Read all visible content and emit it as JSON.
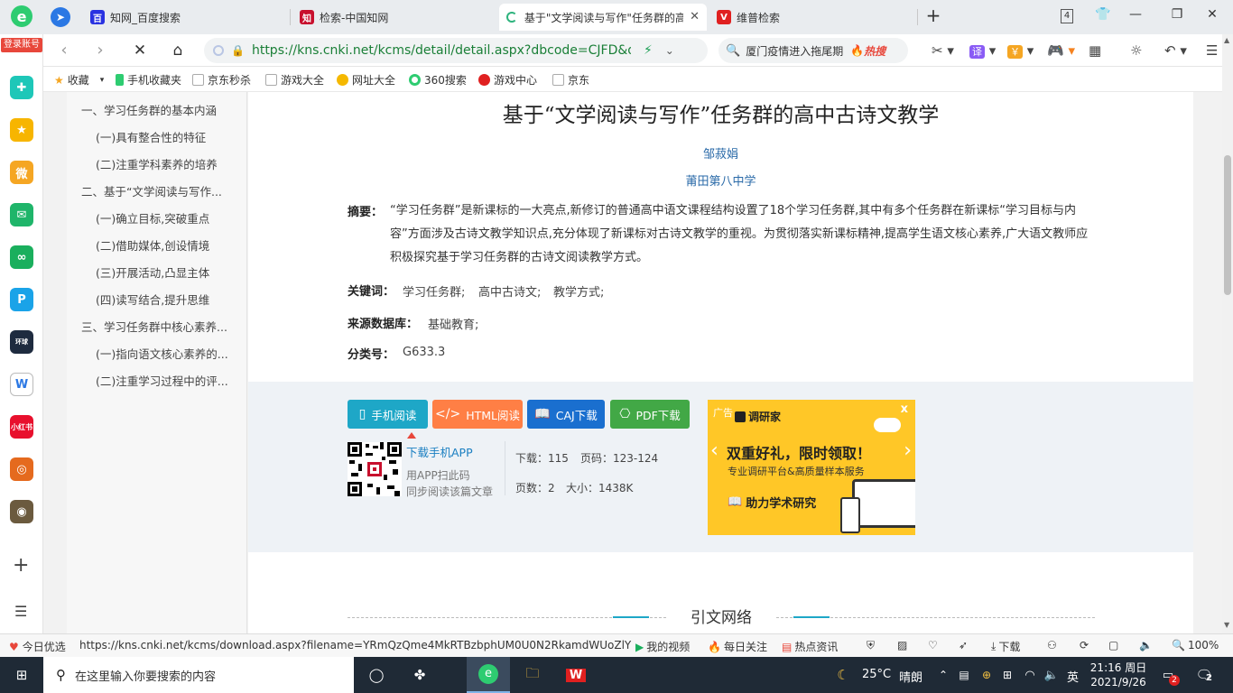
{
  "browser": {
    "tabs": [
      {
        "label": "知网_百度搜索",
        "icon": "baidu-icon",
        "color": "#2932e1",
        "active": false
      },
      {
        "label": "检索-中国知网",
        "icon": "cnki-icon",
        "color": "#c8102e",
        "active": false
      },
      {
        "label": "基于\"文学阅读与写作\"任务群的高中古诗文教学",
        "icon": "loading-icon",
        "color": "#2db37d",
        "active": true
      },
      {
        "label": "维普检索",
        "icon": "weipu-icon",
        "color": "#e02020",
        "active": false
      }
    ],
    "tab_count": "4",
    "address": "https://kns.cnki.net/kcms/detail/detail.aspx?dbcode=CJFD&d",
    "search_hint": "厦门疫情进入拖尾期",
    "search_hot": "热搜",
    "login_label": "登录账号"
  },
  "favorites": [
    "收藏",
    "手机收藏夹",
    "京东秒杀",
    "游戏大全",
    "网址大全",
    "360搜索",
    "游戏中心",
    "京东"
  ],
  "toc": [
    "一、学习任务群的基本内涵",
    "(一)具有整合性的特征",
    "(二)注重学科素养的培养",
    "二、基于“文学阅读与写作...",
    "(一)确立目标,突破重点",
    "(二)借助媒体,创设情境",
    "(三)开展活动,凸显主体",
    "(四)读写结合,提升思维",
    "三、学习任务群中核心素养...",
    "(一)指向语文核心素养的...",
    "(二)注重学习过程中的评..."
  ],
  "article": {
    "title": "基于“文学阅读与写作”任务群的高中古诗文教学",
    "author": "邹菽娟",
    "institution": "莆田第八中学",
    "abstract_label": "摘要：",
    "abstract": "“学习任务群”是新课标的一大亮点,新修订的普通高中语文课程结构设置了18个学习任务群,其中有多个任务群在新课标“学习目标与内容”方面涉及古诗文教学知识点,充分体现了新课标对古诗文教学的重视。为贯彻落实新课标精神,提高学生语文核心素养,广大语文教师应积极探究基于学习任务群的古诗文阅读教学方式。",
    "keywords_label": "关键词：",
    "keywords": [
      "学习任务群;",
      "高中古诗文;",
      "教学方式;"
    ],
    "source_label": "来源数据库：",
    "source": "基础教育;",
    "class_label": "分类号：",
    "class": "G633.3"
  },
  "download": {
    "buttons": [
      {
        "label": "手机阅读",
        "color": "#1ea7c7",
        "icon": "phone-icon"
      },
      {
        "label": "HTML阅读",
        "color": "#ff7f45",
        "icon": "code-icon"
      },
      {
        "label": "CAJ下载",
        "color": "#1a6fcf",
        "icon": "book-icon"
      },
      {
        "label": "PDF下载",
        "color": "#42a846",
        "icon": "pdf-icon"
      }
    ],
    "app_link": "下载手机APP",
    "app_hint1": "用APP扫此码",
    "app_hint2": "同步阅读该篇文章",
    "stats": {
      "downloads_label": "下载：",
      "downloads": "115",
      "pages_label": "页码：",
      "pages": "123-124",
      "page_count_label": "页数：",
      "page_count": "2",
      "size_label": "大小：",
      "size": "1438K"
    }
  },
  "ad": {
    "tag": "广告",
    "brand": "调研家",
    "headline": "双重好礼，限时领取！",
    "sub": "专业调研平台&高质量样本服务",
    "cta": "助力学术研究",
    "close": "x"
  },
  "references": {
    "title": "引文网络"
  },
  "statusbar": {
    "left": "今日优选",
    "url": "https://kns.cnki.net/kcms/download.aspx?filename=YRmQzQme4MkRTBzbphUM0U0N2RkamdWUoZlY3C",
    "items": [
      "我的视频",
      "每日关注",
      "热点资讯"
    ],
    "download": "下载",
    "zoom": "100%"
  },
  "taskbar": {
    "search_placeholder": "在这里输入你要搜索的内容",
    "weather": "25°C",
    "weather_desc": "晴朗",
    "lang": "英",
    "time": "21:16 周日",
    "date": "2021/9/26",
    "notify_count": "2",
    "message_count": "2"
  }
}
